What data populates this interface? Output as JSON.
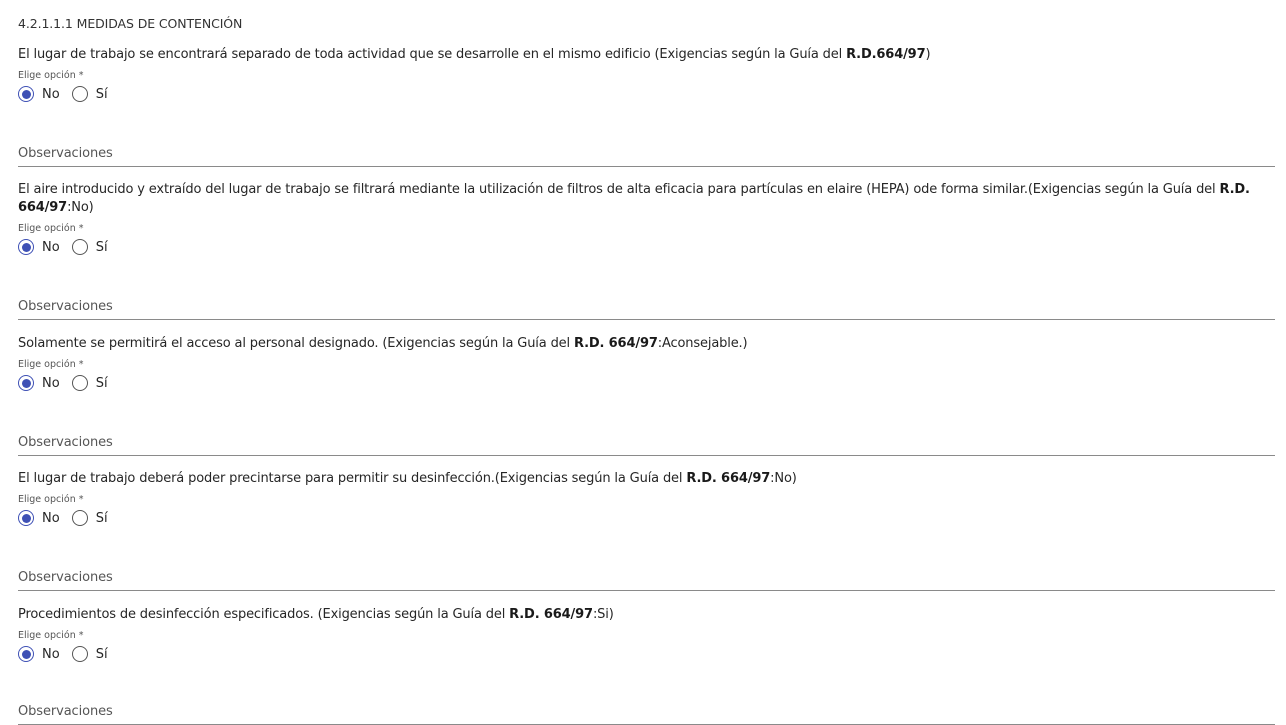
{
  "section_title": "4.2.1.1.1 MEDIDAS DE CONTENCIÓN",
  "choice_label": "Elige opción *",
  "options": {
    "no": "No",
    "si": "Sí"
  },
  "observations_label": "Observaciones",
  "accent_color": "#3f51b5",
  "questions": [
    {
      "text": "El lugar de trabajo se encontrará separado de toda actividad que se desarrolle en el mismo edificio (Exigencias según la Guía del ",
      "bold": "R.D.664/97",
      "tail": ")",
      "selected": "No"
    },
    {
      "text": "El aire introducido y extraído del lugar de trabajo se filtrará mediante la utilización de filtros de alta eficacia para partículas en elaire (HEPA) ode forma similar.(Exigencias según la Guía del ",
      "bold": "R.D. 664/97",
      "tail": ":No)",
      "selected": "No"
    },
    {
      "text": "Solamente se permitirá el acceso al personal designado. (Exigencias según la Guía del ",
      "bold": "R.D. 664/97",
      "tail": ":Aconsejable.)",
      "selected": "No"
    },
    {
      "text": "El lugar de trabajo deberá poder precintarse para permitir su desinfección.(Exigencias según la Guía del ",
      "bold": "R.D. 664/97",
      "tail": ":No)",
      "selected": "No"
    },
    {
      "text": "Procedimientos de desinfección especificados. (Exigencias según la Guía del ",
      "bold": "R.D. 664/97",
      "tail": ":Si)",
      "selected": "No"
    }
  ]
}
